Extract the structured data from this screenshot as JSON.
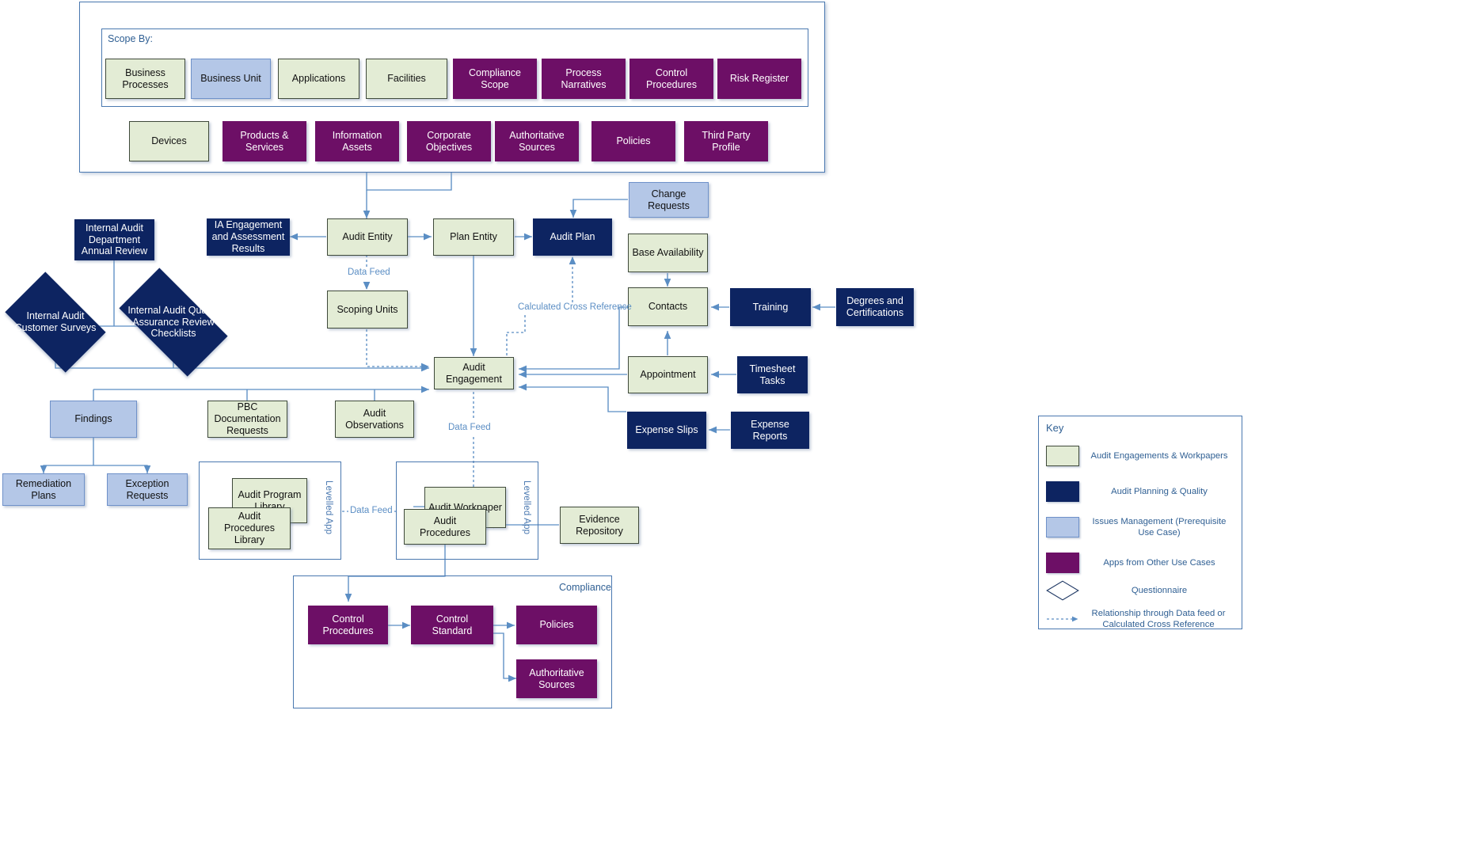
{
  "scope_panel": {
    "title": "Scope By:",
    "row1": [
      {
        "label": "Business Processes",
        "color": "green"
      },
      {
        "label": "Business Unit",
        "color": "lblue"
      },
      {
        "label": "Applications",
        "color": "green"
      },
      {
        "label": "Facilities",
        "color": "green"
      },
      {
        "label": "Compliance Scope",
        "color": "purple"
      },
      {
        "label": "Process Narratives",
        "color": "purple"
      },
      {
        "label": "Control Procedures",
        "color": "purple"
      },
      {
        "label": "Risk Register",
        "color": "purple"
      }
    ],
    "row2": [
      {
        "label": "Devices",
        "color": "green"
      },
      {
        "label": "Products & Services",
        "color": "purple"
      },
      {
        "label": "Information Assets",
        "color": "purple"
      },
      {
        "label": "Corporate Objectives",
        "color": "purple"
      },
      {
        "label": "Authoritative Sources",
        "color": "purple"
      },
      {
        "label": "Policies",
        "color": "purple"
      },
      {
        "label": "Third Party Profile",
        "color": "purple"
      }
    ]
  },
  "nodes": {
    "internal_audit_dept_annual_review": "Internal Audit Department Annual Review",
    "ia_engagement_assessment_results": "IA Engagement and Assessment Results",
    "audit_entity": "Audit Entity",
    "plan_entity": "Plan Entity",
    "audit_plan": "Audit Plan",
    "change_requests": "Change Requests",
    "base_availability": "Base Availability",
    "scoping_units": "Scoping Units",
    "contacts": "Contacts",
    "training": "Training",
    "degrees_and_certifications": "Degrees and Certifications",
    "audit_engagement": "Audit Engagement",
    "appointment": "Appointment",
    "timesheet_tasks": "Timesheet Tasks",
    "expense_slips": "Expense Slips",
    "expense_reports": "Expense Reports",
    "findings": "Findings",
    "pbc_documentation_requests": "PBC Documentation Requests",
    "audit_observations": "Audit Observations",
    "remediation_plans": "Remediation Plans",
    "exception_requests": "Exception Requests",
    "audit_program_library": "Audit Program Library",
    "audit_procedures_library": "Audit Procedures Library",
    "audit_workpaper": "Audit Workpaper",
    "audit_procedures": "Audit Procedures",
    "evidence_repository": "Evidence Repository",
    "control_procedures": "Control Procedures",
    "control_standard": "Control Standard",
    "policies": "Policies",
    "authoritative_sources": "Authoritative Sources",
    "internal_audit_customer_surveys": "Internal Audit Customer Surveys",
    "internal_audit_qa_review_checklists": "Internal Audit Quality Assurance Review Checklists"
  },
  "containers": {
    "compliance_title": "Compliance",
    "levelled_app_left": "Levelled App",
    "levelled_app_right": "Levelled App"
  },
  "edge_labels": {
    "data_feed_1": "Data Feed",
    "data_feed_2": "Data Feed",
    "data_feed_3": "Data Feed",
    "calculated_cross_reference": "Calculated Cross Reference"
  },
  "key": {
    "title": "Key",
    "items": [
      {
        "swatch": "green",
        "label": "Audit Engagements & Workpapers"
      },
      {
        "swatch": "navy",
        "label": "Audit Planning & Quality"
      },
      {
        "swatch": "lblue",
        "label": "Issues Management (Prerequisite Use Case)"
      },
      {
        "swatch": "purple",
        "label": "Apps from Other Use Cases"
      },
      {
        "swatch": "diamond",
        "label": "Questionnaire"
      },
      {
        "swatch": "dotline",
        "label": "Relationship through Data feed or Calculated Cross Reference"
      }
    ]
  },
  "colors": {
    "green": "#e3ecd5",
    "navy": "#0d2461",
    "light_blue": "#b4c7e7",
    "purple": "#6d0f66",
    "connector_blue": "#5b8ec4",
    "panel_border": "#4a78b0"
  }
}
